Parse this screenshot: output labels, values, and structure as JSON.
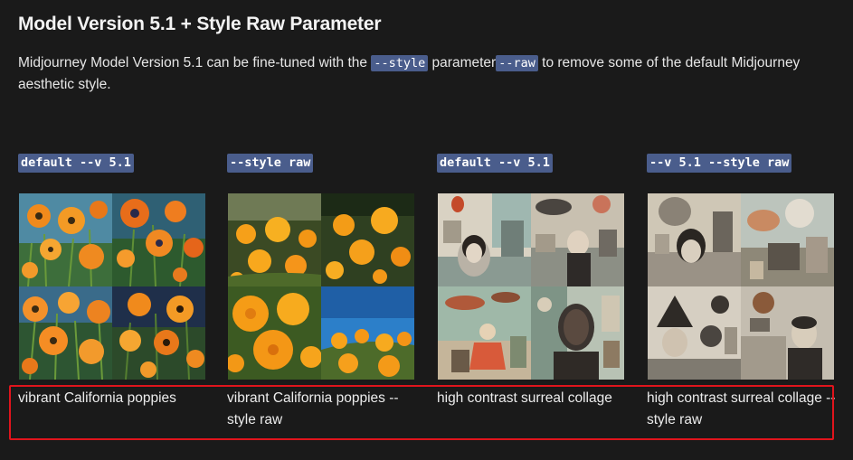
{
  "section": {
    "title": "Model Version 5.1 + Style Raw Parameter",
    "intro_part1": "Midjourney Model Version 5.1 can be fine-tuned with the ",
    "intro_code1": "--style",
    "intro_part2": " parameter",
    "intro_code2": "--raw",
    "intro_part3": " to remove some of the default Midjourney aesthetic style."
  },
  "columns": [
    {
      "label": "default --v 5.1",
      "caption": "vibrant California poppies",
      "image_subject": "painted orange poppies"
    },
    {
      "label": "--style raw",
      "caption": "vibrant California poppies --style raw",
      "image_subject": "photographic orange poppies"
    },
    {
      "label": "default --v 5.1",
      "caption": "high contrast surreal collage",
      "image_subject": "surreal vintage collage"
    },
    {
      "label": "--v 5.1 --style raw",
      "caption": "high contrast surreal collage --style raw",
      "image_subject": "surreal black and white collage"
    }
  ],
  "highlight": {
    "color": "#e0141c"
  },
  "colors": {
    "background": "#1a1a1a",
    "code_background": "#4a5d8c",
    "text": "#ececec"
  }
}
